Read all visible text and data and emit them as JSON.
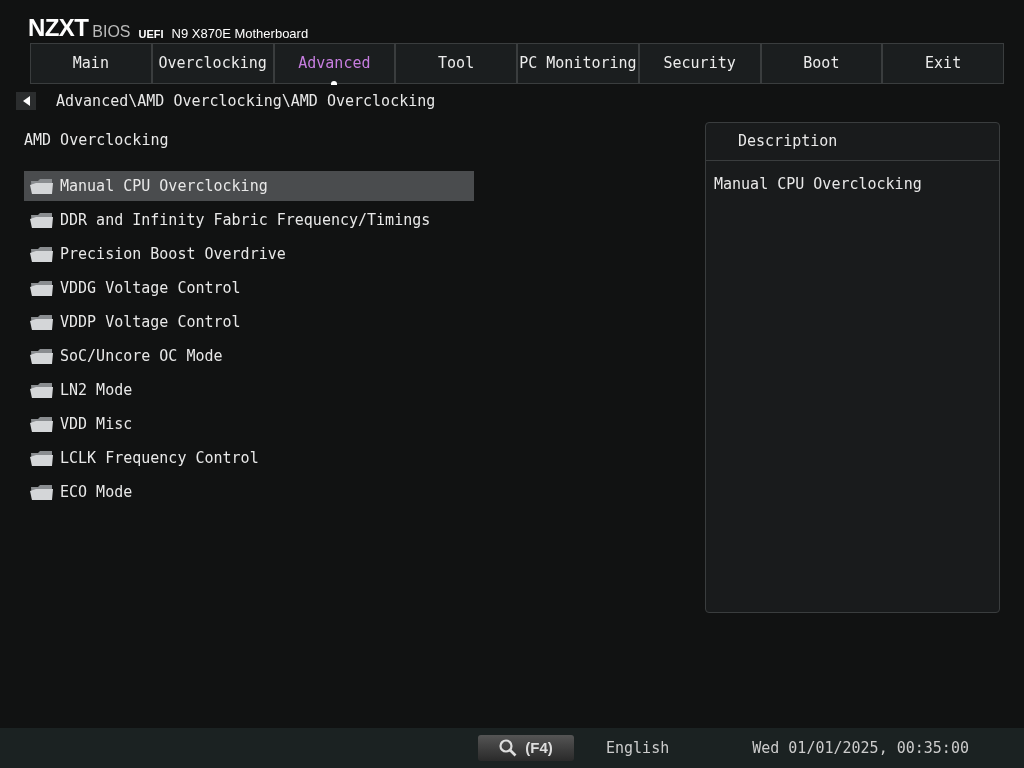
{
  "header": {
    "brand": "NZXT",
    "bios": "BIOS",
    "uefi": "UEFI",
    "model": "N9 X870E Motherboard"
  },
  "tabs": [
    {
      "label": "Main",
      "selected": false
    },
    {
      "label": "Overclocking",
      "selected": false
    },
    {
      "label": "Advanced",
      "selected": true
    },
    {
      "label": "Tool",
      "selected": false
    },
    {
      "label": "PC Monitoring",
      "selected": false
    },
    {
      "label": "Security",
      "selected": false
    },
    {
      "label": "Boot",
      "selected": false
    },
    {
      "label": "Exit",
      "selected": false
    }
  ],
  "breadcrumb": "Advanced\\AMD Overclocking\\AMD Overclocking",
  "section_title": "AMD Overclocking",
  "items": [
    {
      "label": "Manual CPU Overclocking",
      "selected": true
    },
    {
      "label": "DDR and Infinity Fabric Frequency/Timings",
      "selected": false
    },
    {
      "label": "Precision Boost Overdrive",
      "selected": false
    },
    {
      "label": "VDDG Voltage Control",
      "selected": false
    },
    {
      "label": "VDDP Voltage Control",
      "selected": false
    },
    {
      "label": "SoC/Uncore OC Mode",
      "selected": false
    },
    {
      "label": "LN2 Mode",
      "selected": false
    },
    {
      "label": "VDD Misc",
      "selected": false
    },
    {
      "label": "LCLK Frequency Control",
      "selected": false
    },
    {
      "label": "ECO Mode",
      "selected": false
    }
  ],
  "description": {
    "title": "Description",
    "text": "Manual CPU Overclocking"
  },
  "status_bar": {
    "search_key": "(F4)",
    "language": "English",
    "datetime": "Wed 01/01/2025, 00:35:00"
  }
}
